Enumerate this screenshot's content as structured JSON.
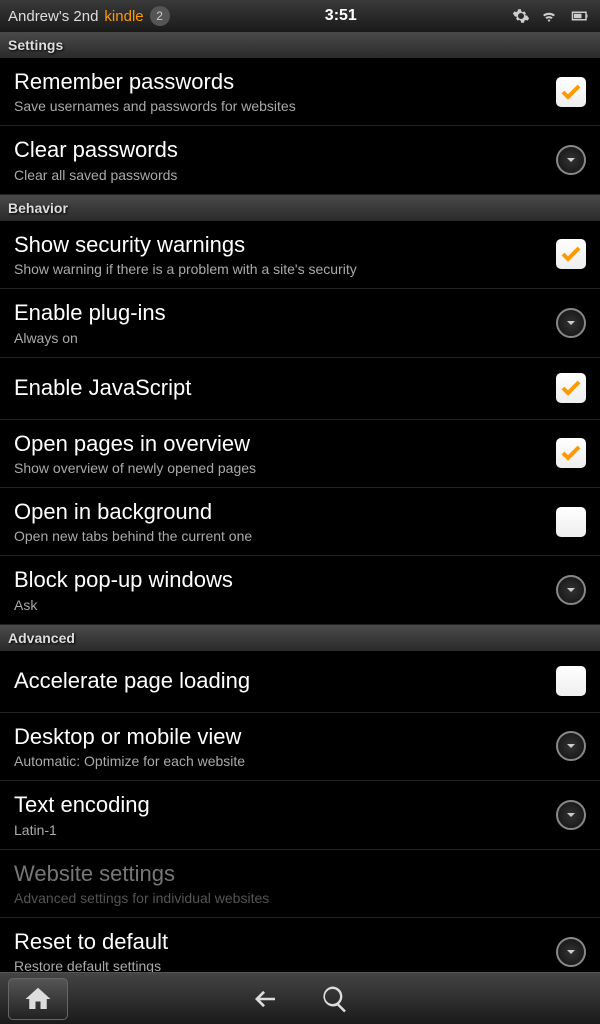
{
  "statusbar": {
    "device_prefix": "Andrew's 2nd",
    "device_brand": "kindle",
    "badge": "2",
    "time": "3:51"
  },
  "sections": {
    "settings": "Settings",
    "behavior": "Behavior",
    "advanced": "Advanced"
  },
  "items": {
    "remember_pw": {
      "title": "Remember passwords",
      "sub": "Save usernames and passwords for websites"
    },
    "clear_pw": {
      "title": "Clear passwords",
      "sub": "Clear all saved passwords"
    },
    "security": {
      "title": "Show security warnings",
      "sub": "Show warning if there is a problem with a site's security"
    },
    "plugins": {
      "title": "Enable plug-ins",
      "sub": "Always on"
    },
    "javascript": {
      "title": "Enable JavaScript"
    },
    "overview": {
      "title": "Open pages in overview",
      "sub": "Show overview of newly opened pages"
    },
    "background": {
      "title": "Open in background",
      "sub": "Open new tabs behind the current one"
    },
    "popup": {
      "title": "Block pop-up windows",
      "sub": "Ask"
    },
    "accelerate": {
      "title": "Accelerate page loading"
    },
    "desktop": {
      "title": "Desktop or mobile view",
      "sub": "Automatic: Optimize for each website"
    },
    "encoding": {
      "title": "Text encoding",
      "sub": "Latin-1"
    },
    "website": {
      "title": "Website settings",
      "sub": "Advanced settings for individual websites"
    },
    "reset": {
      "title": "Reset to default",
      "sub": "Restore default settings"
    }
  }
}
